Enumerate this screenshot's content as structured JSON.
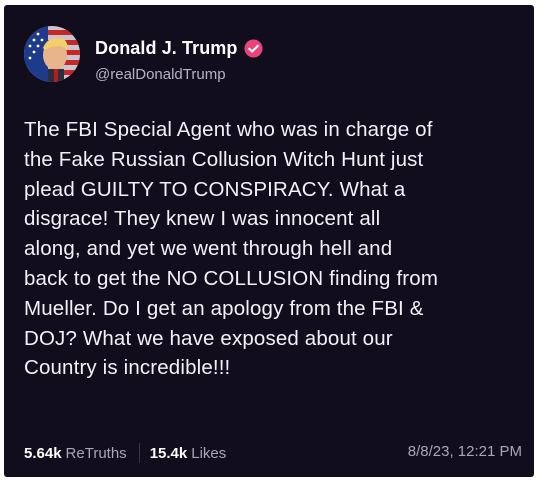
{
  "post": {
    "author": {
      "display_name": "Donald J. Trump",
      "handle": "@realDonaldTrump",
      "verified": true
    },
    "text": "The FBI Special Agent who was in charge of\nthe Fake Russian Collusion Witch Hunt just\nplead GUILTY TO CONSPIRACY. What a\ndisgrace! They knew I was innocent all\nalong, and yet we went through hell and\nback to get the NO COLLUSION finding from\nMueller. Do I get an apology from the FBI &\nDOJ? What we have exposed about our\nCountry is incredible!!!",
    "retruths_count": "5.64k",
    "retruths_label": "ReTruths",
    "likes_count": "15.4k",
    "likes_label": "Likes",
    "timestamp": "8/8/23, 12:21 PM"
  },
  "colors": {
    "card_background": "#110d1c",
    "verified_badge": "#e9457a",
    "muted_text": "#a9a5b5"
  }
}
